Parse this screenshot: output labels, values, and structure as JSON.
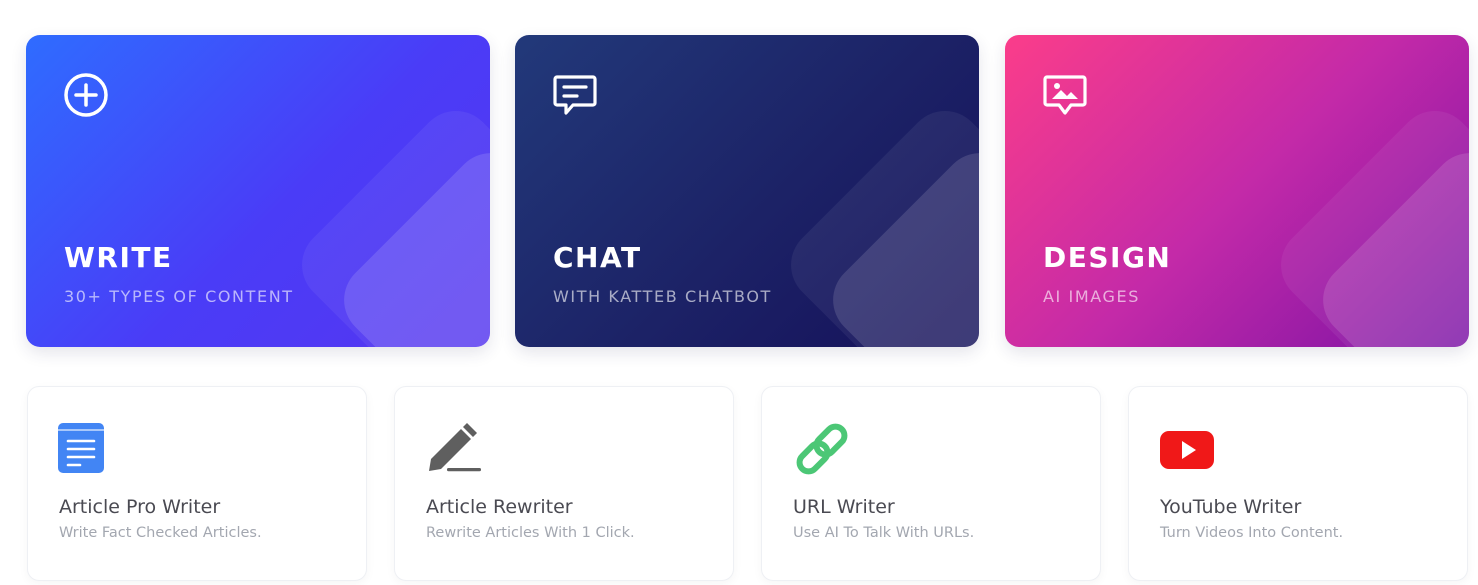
{
  "hero_cards": [
    {
      "title": "WRITE",
      "subtitle": "30+ TYPES OF CONTENT",
      "icon": "plus-circle-icon"
    },
    {
      "title": "CHAT",
      "subtitle": "WITH KATTEB CHATBOT",
      "icon": "chat-bubble-icon"
    },
    {
      "title": "DESIGN",
      "subtitle": "AI IMAGES",
      "icon": "image-bubble-icon"
    }
  ],
  "tools": [
    {
      "title": "Article Pro Writer",
      "description": "Write Fact Checked Articles.",
      "icon": "document-icon",
      "icon_color": "#4285f4"
    },
    {
      "title": "Article Rewriter",
      "description": "Rewrite Articles With 1 Click.",
      "icon": "pencil-icon",
      "icon_color": "#5f5f5f"
    },
    {
      "title": "URL Writer",
      "description": "Use AI To Talk With URLs.",
      "icon": "link-icon",
      "icon_color": "#4cc776"
    },
    {
      "title": "YouTube Writer",
      "description": "Turn Videos Into Content.",
      "icon": "youtube-icon",
      "icon_color": "#f01818"
    }
  ],
  "colors": {
    "write_gradient": [
      "#2f6cff",
      "#5536f0"
    ],
    "chat_gradient": [
      "#22397a",
      "#15105a"
    ],
    "design_gradient": [
      "#fb3d8a",
      "#7a12a5"
    ]
  }
}
